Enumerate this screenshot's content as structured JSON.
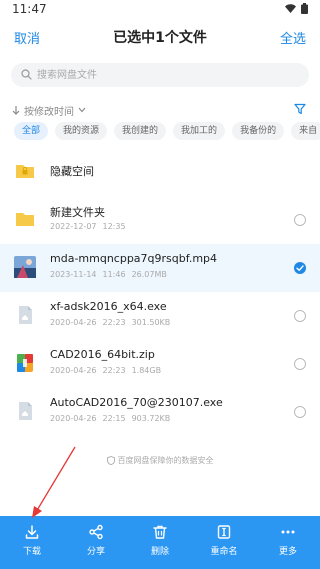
{
  "status_bar": {
    "time": "11:47"
  },
  "header": {
    "cancel": "取消",
    "title": "已选中1个文件",
    "select_all": "全选"
  },
  "search": {
    "placeholder": "搜索网盘文件"
  },
  "sort": {
    "label": "按修改时间"
  },
  "chips": [
    {
      "label": "全部",
      "active": true
    },
    {
      "label": "我的资源"
    },
    {
      "label": "我创建的"
    },
    {
      "label": "我加工的"
    },
    {
      "label": "我备份的"
    },
    {
      "label": "来自"
    }
  ],
  "files": [
    {
      "name": "隐藏空间",
      "icon": "hidden-folder-icon"
    },
    {
      "name": "新建文件夹",
      "date": "2022-12-07",
      "time": "12:35",
      "icon": "folder-icon",
      "checked": false
    },
    {
      "name": "mda-mmqncppa7q9rsqbf.mp4",
      "date": "2023-11-14",
      "time": "11:46",
      "size": "26.07MB",
      "icon": "video-thumbnail",
      "checked": true
    },
    {
      "name": "xf-adsk2016_x64.exe",
      "date": "2020-04-26",
      "time": "22:23",
      "size": "301.50KB",
      "icon": "exe-file-icon",
      "checked": false
    },
    {
      "name": "CAD2016_64bit.zip",
      "date": "2020-04-26",
      "time": "22:23",
      "size": "1.84GB",
      "icon": "zip-file-icon",
      "checked": false
    },
    {
      "name": "AutoCAD2016_70@230107.exe",
      "date": "2020-04-26",
      "time": "22:15",
      "size": "903.72KB",
      "icon": "exe-file-icon",
      "checked": false
    }
  ],
  "footer_note": "百度网盘保障你的数据安全",
  "toolbar": {
    "download": "下载",
    "share": "分享",
    "delete": "删除",
    "rename": "重命名",
    "more": "更多"
  },
  "colors": {
    "accent": "#1e88e5",
    "toolbar_bg": "#2b97f3",
    "selected_row": "#eef6fe",
    "annotation_arrow": "#e53935"
  }
}
